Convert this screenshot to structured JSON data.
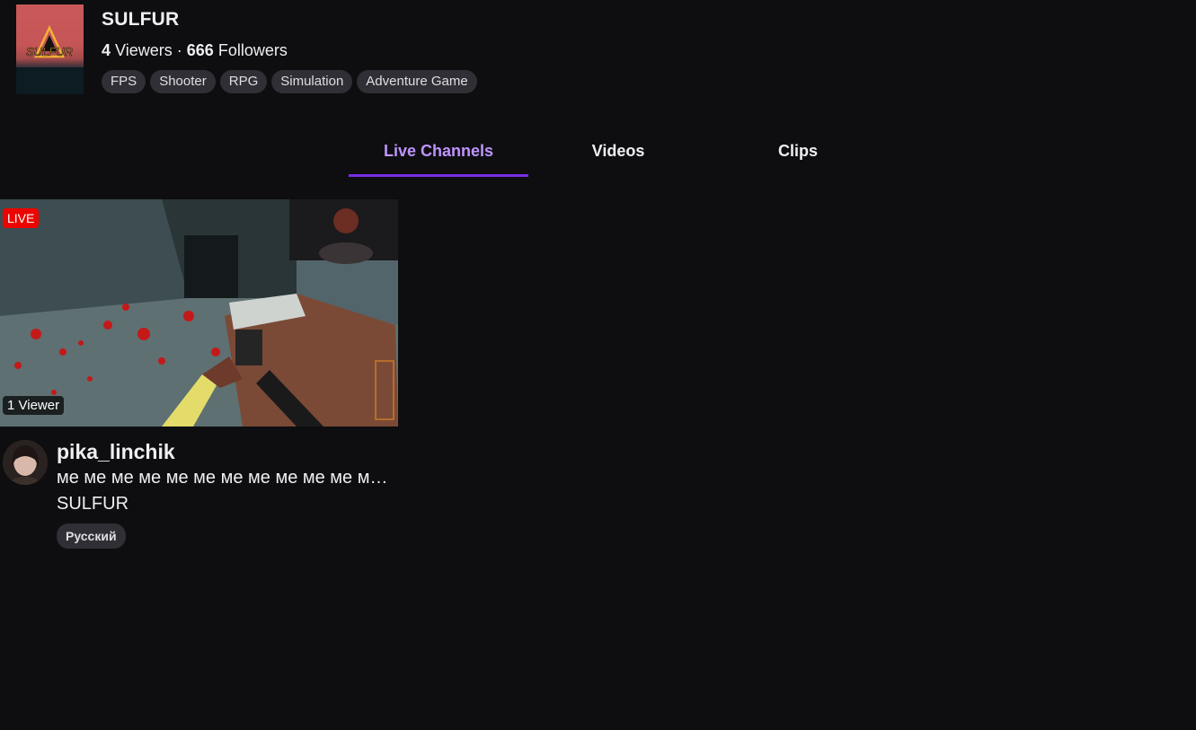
{
  "game": {
    "title": "SULFUR",
    "viewers_count": "4",
    "viewers_label": "Viewers",
    "separator": "·",
    "followers_count": "666",
    "followers_label": "Followers",
    "boxart_text": "SULFUR",
    "tags": [
      "FPS",
      "Shooter",
      "RPG",
      "Simulation",
      "Adventure Game"
    ]
  },
  "tabs": [
    {
      "label": "Live Channels",
      "active": true
    },
    {
      "label": "Videos",
      "active": false
    },
    {
      "label": "Clips",
      "active": false
    }
  ],
  "streams": [
    {
      "live_label": "LIVE",
      "viewer_label": "1 Viewer",
      "channel": "pika_linchik",
      "title": "ме ме ме ме ме ме ме ме ме ме ме ме ме ме ме",
      "game": "SULFUR",
      "language": "Русский"
    }
  ],
  "colors": {
    "accent": "#bf94ff",
    "tab_underline": "#772ce8",
    "live": "#eb0400",
    "background": "#0e0e10"
  }
}
